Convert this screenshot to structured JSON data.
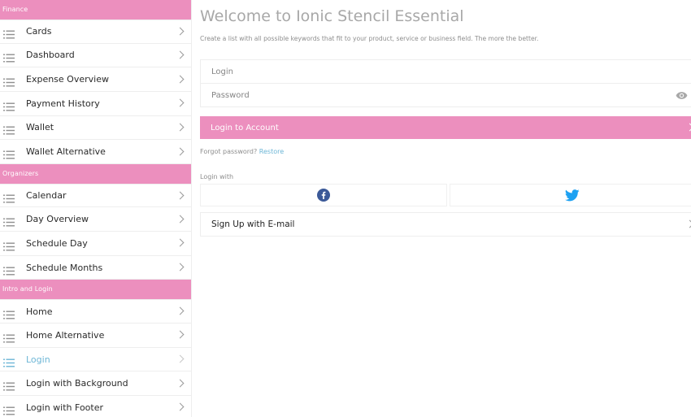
{
  "sidebar": {
    "sections": [
      {
        "title": "Finance",
        "items": [
          {
            "label": "Cards"
          },
          {
            "label": "Dashboard"
          },
          {
            "label": "Expense Overview"
          },
          {
            "label": "Payment History"
          },
          {
            "label": "Wallet"
          },
          {
            "label": "Wallet Alternative"
          }
        ]
      },
      {
        "title": "Organizers",
        "items": [
          {
            "label": "Calendar"
          },
          {
            "label": "Day Overview"
          },
          {
            "label": "Schedule Day"
          },
          {
            "label": "Schedule Months"
          }
        ]
      },
      {
        "title": "Intro and Login",
        "items": [
          {
            "label": "Home"
          },
          {
            "label": "Home Alternative"
          },
          {
            "label": "Login",
            "active": true
          },
          {
            "label": "Login with Background"
          },
          {
            "label": "Login with Footer"
          }
        ]
      }
    ],
    "item_icon": "list-icon"
  },
  "main": {
    "title": "Welcome to Ionic Stencil Essential",
    "subtitle": "Create a list with all possible keywords that fit to your product, service or business field. The more the better.",
    "login_placeholder": "Login",
    "password_placeholder": "Password",
    "password_icon": "eye-icon",
    "login_button": "Login to Account",
    "forgot_text": "Forgot password?",
    "restore_link": "Restore",
    "login_with": "Login with",
    "social": [
      {
        "name": "facebook-icon"
      },
      {
        "name": "twitter-icon"
      }
    ],
    "signup": "Sign Up with E-mail"
  },
  "colors": {
    "accent_pink": "#ec8fbe",
    "link_blue": "#6db6d6",
    "facebook_blue": "#3b5998",
    "twitter_blue": "#1da1f2"
  }
}
